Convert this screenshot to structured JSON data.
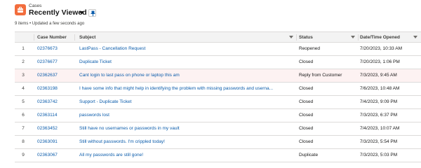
{
  "header": {
    "object_type": "Cases",
    "list_title": "Recently Viewed",
    "meta": "9 items • Updated a few seconds ago",
    "icon": "case-icon",
    "accent": "#f26d3d"
  },
  "table": {
    "columns": {
      "case_number": "Case Number",
      "subject": "Subject",
      "status": "Status",
      "date": "Date/Time Opened"
    },
    "rows": [
      {
        "n": "1",
        "case": "02376673",
        "subject": "LastPass - Cancellation Request",
        "status": "Reopened",
        "date": "7/20/2023, 10:33 AM"
      },
      {
        "n": "2",
        "case": "02376677",
        "subject": "Duplicate Ticket",
        "status": "Closed",
        "date": "7/20/2023, 1:06 PM"
      },
      {
        "n": "3",
        "case": "02362637",
        "subject": "Cant login to last pass on phone or laptop this am",
        "status": "Reply from Customer",
        "date": "7/3/2023, 9:45 AM"
      },
      {
        "n": "4",
        "case": "02363198",
        "subject": "I have some info that might help in identifying the problem with missing passwords and userna...",
        "status": "Closed",
        "date": "7/6/2023, 10:48 AM"
      },
      {
        "n": "5",
        "case": "02363742",
        "subject": "Support - Duplicate Ticket",
        "status": "Closed",
        "date": "7/4/2023, 9:09 PM"
      },
      {
        "n": "6",
        "case": "02363114",
        "subject": "passwords lost",
        "status": "Closed",
        "date": "7/3/2023, 6:37 PM"
      },
      {
        "n": "7",
        "case": "02363452",
        "subject": "Still have no usernames or passwords in my vault",
        "status": "Closed",
        "date": "7/4/2023, 10:07 AM"
      },
      {
        "n": "8",
        "case": "02363091",
        "subject": "Still without passwords. I'm crippled today!",
        "status": "Closed",
        "date": "7/3/2023, 5:54 PM"
      },
      {
        "n": "9",
        "case": "02363067",
        "subject": "All my passwords are still gone!",
        "status": "Duplicate",
        "date": "7/3/2023, 5:03 PM"
      }
    ]
  }
}
